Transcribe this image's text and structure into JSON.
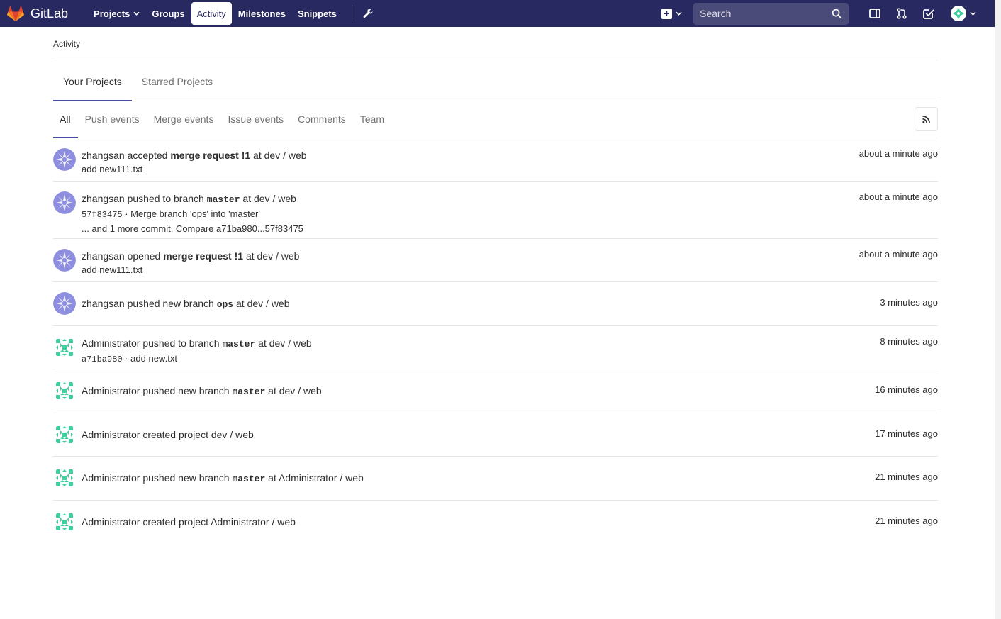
{
  "navbar": {
    "brand": "GitLab",
    "links": [
      "Projects",
      "Groups",
      "Activity",
      "Milestones",
      "Snippets"
    ],
    "active_link": "Activity",
    "search_placeholder": "Search",
    "colors": {
      "navbar_bg": "#292961",
      "accent": "#4b4ba3"
    }
  },
  "breadcrumb": "Activity",
  "project_tabs": [
    "Your Projects",
    "Starred Projects"
  ],
  "filters": [
    "All",
    "Push events",
    "Merge events",
    "Issue events",
    "Comments",
    "Team"
  ],
  "events": [
    {
      "user": "zhangsan",
      "action": "accepted",
      "target": "merge request !1",
      "prep": "at",
      "project": "dev / web",
      "sub": "add new111.txt",
      "time": "about a minute ago"
    },
    {
      "user": "zhangsan",
      "action": "pushed to branch",
      "branch": "master",
      "prep": "at",
      "project": "dev / web",
      "commit": "57f83475",
      "commit_msg": "· Merge branch 'ops' into 'master'",
      "sub2": "... and 1 more commit. Compare a71ba980...57f83475",
      "time": "about a minute ago"
    },
    {
      "user": "zhangsan",
      "action": "opened",
      "target": "merge request !1",
      "prep": "at",
      "project": "dev / web",
      "sub": "add new111.txt",
      "time": "about a minute ago"
    },
    {
      "user": "zhangsan",
      "action": "pushed new branch",
      "branch": "ops",
      "prep": "at",
      "project": "dev / web",
      "time": "3 minutes ago"
    },
    {
      "user": "Administrator",
      "action": "pushed to branch",
      "branch": "master",
      "prep": "at",
      "project": "dev / web",
      "commit": "a71ba980",
      "commit_msg": "· add new.txt",
      "time": "8 minutes ago"
    },
    {
      "user": "Administrator",
      "action": "pushed new branch",
      "branch": "master",
      "prep": "at",
      "project": "dev / web",
      "time": "16 minutes ago"
    },
    {
      "user": "Administrator",
      "action": "created project",
      "project": "dev / web",
      "time": "17 minutes ago"
    },
    {
      "user": "Administrator",
      "action": "pushed new branch",
      "branch": "master",
      "prep": "at",
      "project": "Administrator / web",
      "time": "21 minutes ago"
    },
    {
      "user": "Administrator",
      "action": "created project",
      "project": "Administrator / web",
      "time": "21 minutes ago"
    }
  ]
}
